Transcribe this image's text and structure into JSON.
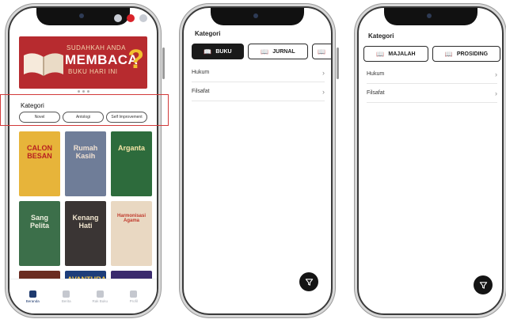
{
  "phone1": {
    "banner": {
      "line1": "SUDAHKAH ANDA",
      "line2": "MEMBACA",
      "line3": "BUKU HARI INI",
      "mark": "?"
    },
    "kategori_title": "Kategori",
    "chips": [
      "Novel",
      "Antologi",
      "Self Improvement"
    ],
    "books": [
      {
        "title": "CALON BESAN",
        "bg": "#e7b43a",
        "fg": "#b82020"
      },
      {
        "title": "Rumah Kasih",
        "bg": "#6f7d98",
        "fg": "#f2e2d2"
      },
      {
        "title": "Arganta",
        "bg": "#2d6b3c",
        "fg": "#f7e6a8"
      },
      {
        "title": "Sang Pelita",
        "bg": "#3c6f4a",
        "fg": "#f0f0e0"
      },
      {
        "title": "Kenang Hati",
        "bg": "#3a3534",
        "fg": "#f2e6cf"
      },
      {
        "title": "Harmonisasi Agama",
        "bg": "#e9d8c2",
        "fg": "#c0392b"
      },
      {
        "title": "",
        "bg": "#6b2d22",
        "fg": "#ffffff"
      },
      {
        "title": "AVANTURA",
        "bg": "#1d3d7a",
        "fg": "#f3c64a"
      },
      {
        "title": "",
        "bg": "#3a2a6d",
        "fg": "#ffffff"
      }
    ],
    "nav": [
      {
        "label": "Beranda",
        "active": true
      },
      {
        "label": "Berita",
        "active": false
      },
      {
        "label": "Rak Buku",
        "active": false
      },
      {
        "label": "Profil",
        "active": false
      }
    ]
  },
  "phone2": {
    "kategori_title": "Kategori",
    "tabs": [
      "BUKU",
      "JURNAL"
    ],
    "rows": [
      "Hukum",
      "Filsafat"
    ]
  },
  "phone3": {
    "kategori_title": "Kategori",
    "tabs": [
      "MAJALAH",
      "PROSIDING"
    ],
    "rows": [
      "Hukum",
      "Filsafat"
    ]
  },
  "icons": {
    "book": "open-book-icon",
    "chevron": "chevron-right-icon",
    "filter": "filter-icon"
  },
  "colors": {
    "banner_red": "#b72b2f",
    "highlight_red": "#d23a3a",
    "active_tab": "#1a1a1a",
    "nav_active": "#1e3a6e"
  }
}
